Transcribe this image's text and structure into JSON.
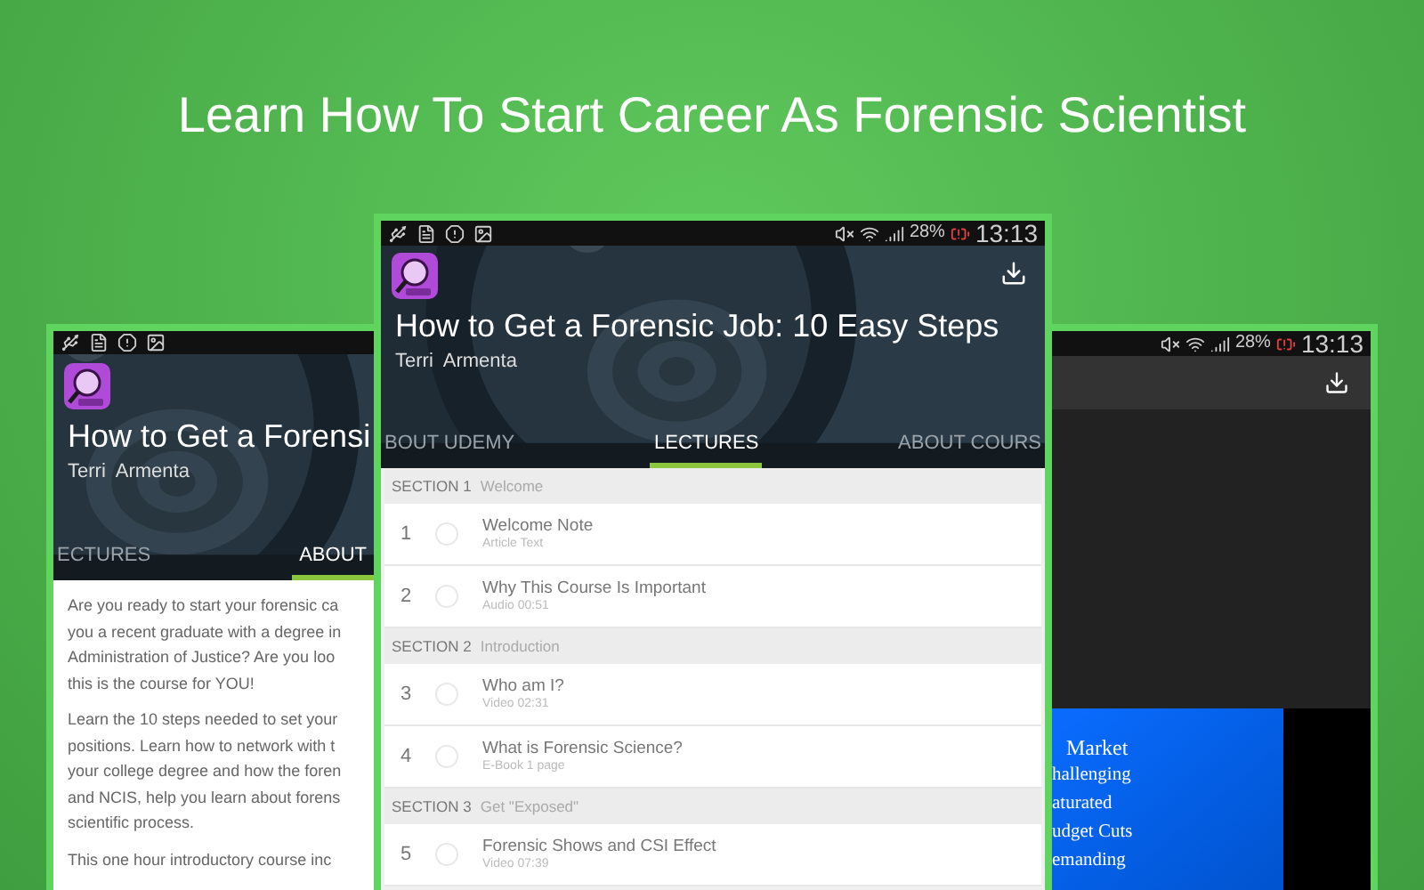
{
  "headline": "Learn How To Start Career As Forensic Scientist",
  "left_phone": {
    "title": "How to Get a Forensi",
    "author": "Terri  Armenta",
    "tabs": [
      {
        "label": "ECTURES",
        "selected": false
      },
      {
        "label": "ABOUT",
        "selected": true
      }
    ],
    "paragraphs": [
      [
        "Are you ready to start your forensic ca",
        "you a recent graduate with a degree in",
        "Administration of Justice? Are you loo",
        "this is the course for YOU!"
      ],
      [
        "Learn the 10 steps needed to set your",
        "positions. Learn how to network with t",
        "your college degree and how the foren",
        "and NCIS, help you learn about forens",
        "scientific process."
      ],
      [
        "This one hour introductory course inc"
      ]
    ]
  },
  "center_phone": {
    "status": {
      "battery": "28%",
      "time": "13:13"
    },
    "title": "How to Get a Forensic Job: 10 Easy Steps",
    "author": "Terri  Armenta",
    "tabs": [
      {
        "label": "BOUT UDEMY",
        "selected": false
      },
      {
        "label": "LECTURES",
        "selected": true
      },
      {
        "label": "ABOUT COURS",
        "selected": false
      }
    ],
    "sections": [
      {
        "label": "SECTION 1",
        "name": "Welcome",
        "lectures": [
          {
            "number": "1",
            "title": "Welcome Note",
            "meta": "Article Text"
          },
          {
            "number": "2",
            "title": "Why This Course Is Important",
            "meta": "Audio 00:51"
          }
        ]
      },
      {
        "label": "SECTION 2",
        "name": "Introduction",
        "lectures": [
          {
            "number": "3",
            "title": "Who am I?",
            "meta": "Video 02:31"
          },
          {
            "number": "4",
            "title": "What is Forensic Science?",
            "meta": "E-Book 1 page"
          }
        ]
      },
      {
        "label": "SECTION 3",
        "name": "Get \"Exposed\"",
        "lectures": [
          {
            "number": "5",
            "title": "Forensic Shows and CSI Effect",
            "meta": "Video 07:39"
          }
        ]
      }
    ]
  },
  "right_phone": {
    "status": {
      "battery": "28%",
      "time": "13:13"
    },
    "slide_lines": [
      "Market",
      "hallenging",
      "aturated",
      "udget Cuts",
      "emanding"
    ]
  }
}
